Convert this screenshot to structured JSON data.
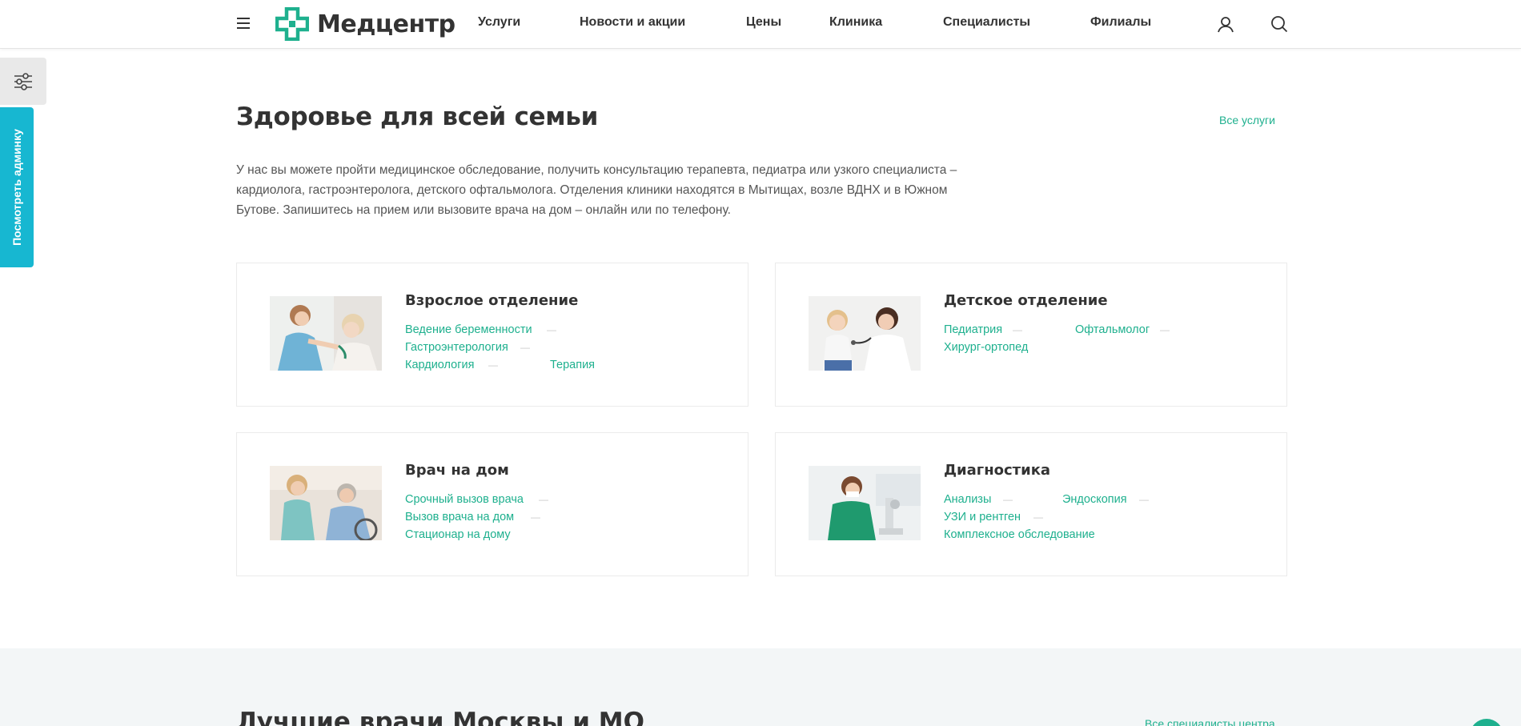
{
  "brand": {
    "name": "Медцентр",
    "accent_color": "#1eb08e",
    "logo_icon": "cross-logo-icon"
  },
  "header": {
    "nav": [
      "Услуги",
      "Новости и акции",
      "Цены",
      "Клиника",
      "Специалисты",
      "Филиалы"
    ],
    "icons": [
      "menu-icon",
      "user-icon",
      "search-icon"
    ]
  },
  "side_panel": {
    "settings_icon": "sliders-icon",
    "admin_label": "Посмотреть админку"
  },
  "main": {
    "title": "Здоровье для всей семьи",
    "all_link": "Все услуги",
    "intro_lines": [
      "У нас вы можете пройти медицинское обследование, получить консультацию терапевта, педиатра или узкого специалиста –",
      "кардиолога, гастроэнтеролога, детского офтальмолога. Отделения клиники находятся в Мытищах, возле ВДНХ и в Южном",
      "Бутове. Запишитесь на прием или вызовите врача на дом – онлайн или по телефону."
    ]
  },
  "cards": [
    {
      "title": "Взрослое отделение",
      "links": [
        "Ведение беременности",
        "Гастроэнтерология",
        "Кардиология",
        "Терапия"
      ]
    },
    {
      "title": "Детское отделение",
      "links": [
        "Педиатрия",
        "Офтальмолог",
        "Хирург-ортопед"
      ]
    },
    {
      "title": "Врач на дом",
      "links": [
        "Срочный вызов врача",
        "Вызов врача на дом",
        "Стационар на дому"
      ]
    },
    {
      "title": "Диагностика",
      "links": [
        "Анализы",
        "Эндоскопия",
        "УЗИ и рентген",
        "Комплексное обследование"
      ]
    }
  ],
  "bottom": {
    "title": "Лучшие врачи Москвы и МО",
    "all_link": "Все специалисты центра"
  },
  "separator": "—"
}
